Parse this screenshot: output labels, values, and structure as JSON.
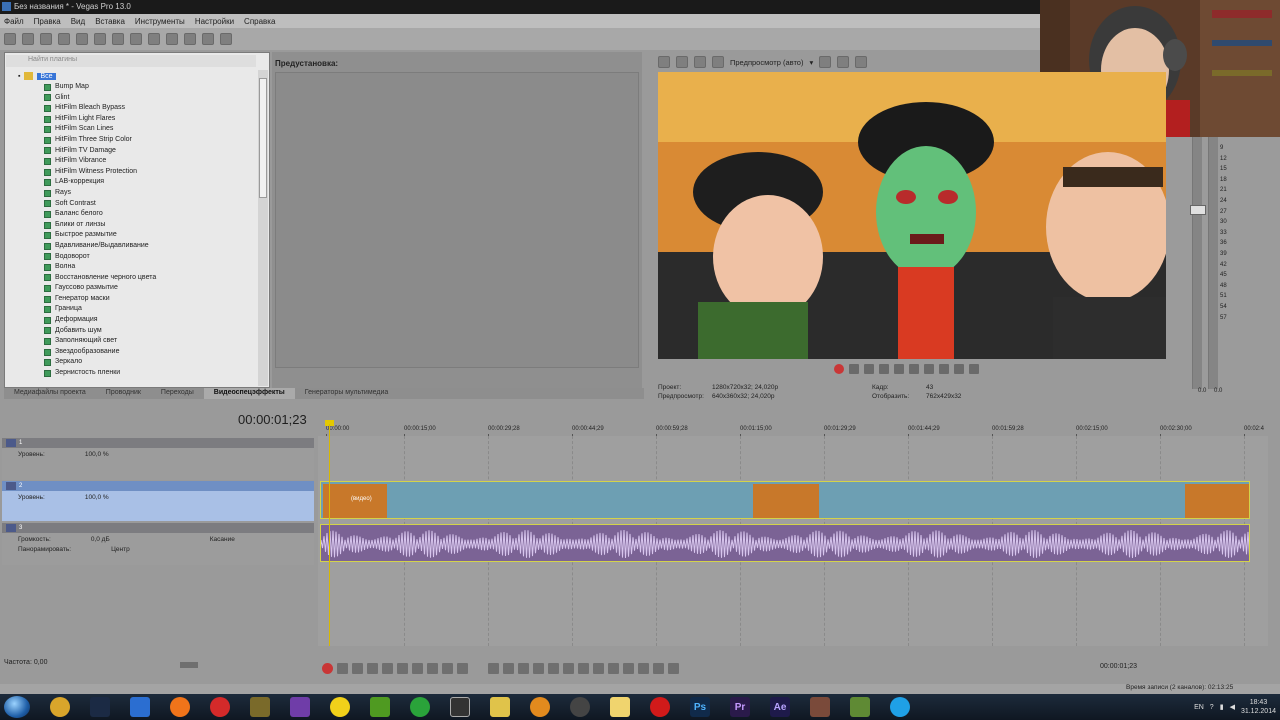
{
  "window": {
    "title": "Без названия * - Vegas Pro 13.0"
  },
  "menu": [
    "Файл",
    "Правка",
    "Вид",
    "Вставка",
    "Инструменты",
    "Настройки",
    "Справка"
  ],
  "browser": {
    "search_placeholder": "Найти плагины",
    "root_label": "Все",
    "items": [
      "Bump Map",
      "Glint",
      "HitFilm Bleach Bypass",
      "HitFilm Light Flares",
      "HitFilm Scan Lines",
      "HitFilm Three Strip Color",
      "HitFilm TV Damage",
      "HitFilm Vibrance",
      "HitFilm Witness Protection",
      "LAB-коррекция",
      "Rays",
      "Soft Contrast",
      "Баланс белого",
      "Блики от линзы",
      "Быстрое размытие",
      "Вдавливание/Выдавливание",
      "Водоворот",
      "Волна",
      "Восстановление черного цвета",
      "Гауссово размытие",
      "Генератор маски",
      "Граница",
      "Деформация",
      "Добавить шум",
      "Заполняющий свет",
      "Звездообразование",
      "Зеркало",
      "Зернистость пленки"
    ]
  },
  "presets": {
    "title": "Предустановка:"
  },
  "tabs": [
    "Медиафайлы проекта",
    "Проводник",
    "Переходы",
    "Видеоспецэффекты",
    "Генераторы мультимедиа"
  ],
  "active_tab": 3,
  "preview": {
    "mode_label": "Предпросмотр (авто)",
    "info": {
      "project_label": "Проект:",
      "project_value": "1280x720x32; 24,020р",
      "preview_label": "Предпросмотр:",
      "preview_value": "640x360x32; 24,020р",
      "frame_label": "Кадр:",
      "frame_value": "43",
      "display_label": "Отобразить:",
      "display_value": "762x429x32"
    }
  },
  "meter_scale": [
    "9",
    "12",
    "15",
    "18",
    "21",
    "24",
    "27",
    "30",
    "33",
    "36",
    "39",
    "42",
    "45",
    "48",
    "51",
    "54",
    "57"
  ],
  "meter_bottom": [
    "0.0",
    "0.0"
  ],
  "timeline": {
    "timecode": "00:00:01;23",
    "ruler": [
      "00:00:00",
      "00:00:15;00",
      "00:00:29;28",
      "00:00:44;29",
      "00:00:59;28",
      "00:01:15;00",
      "00:01:29;29",
      "00:01:44;29",
      "00:01:59;28",
      "00:02:15;00",
      "00:02:30;00",
      "00:02:4"
    ],
    "tracks": [
      {
        "num": "1",
        "level_label": "Уровень:",
        "level_value": "100,0 %"
      },
      {
        "num": "2",
        "level_label": "Уровень:",
        "level_value": "100,0 %"
      },
      {
        "num": "3",
        "volume_label": "Громкость:",
        "volume_value": "0,0 дБ",
        "pan_label": "Панорамировать:",
        "pan_value": "Центр",
        "mode_label": "Касание"
      }
    ],
    "clip_label": "(видео)"
  },
  "bottom": {
    "rate_label": "Частота: 0,00",
    "timecode": "00:00:01;23",
    "record_time": "Время записи (2 каналов): 02:13:25"
  },
  "taskbar": {
    "lang": "EN",
    "time": "18:43",
    "date": "31.12.2014",
    "apps": [
      "chrome",
      "steam",
      "uplay",
      "origin",
      "record",
      "game",
      "vs",
      "pacman",
      "nvidia",
      "g",
      "vegas",
      "folder",
      "flash",
      "steam2",
      "explorer",
      "opera",
      "Ps",
      "Pr",
      "Ae",
      "tool",
      "minecraft",
      "skype"
    ]
  },
  "colors": {
    "accent": "#3875d7",
    "videoTrack": "#6d9fb3",
    "audioTrack": "#7b6395",
    "playhead": "#d8b800"
  }
}
